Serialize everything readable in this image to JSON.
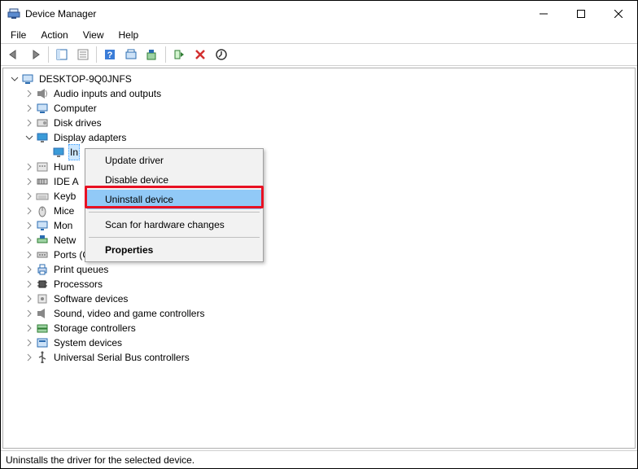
{
  "window": {
    "title": "Device Manager"
  },
  "menu": {
    "file": "File",
    "action": "Action",
    "view": "View",
    "help": "Help"
  },
  "tree": {
    "root": "DESKTOP-9Q0JNFS",
    "items": [
      {
        "label": "Audio inputs and outputs",
        "icon": "audio"
      },
      {
        "label": "Computer",
        "icon": "computer"
      },
      {
        "label": "Disk drives",
        "icon": "disk"
      },
      {
        "label": "Display adapters",
        "icon": "display",
        "expanded": true
      },
      {
        "label": "Human Interface Devices",
        "icon": "hid",
        "truncated": "Hum"
      },
      {
        "label": "IDE ATA/ATAPI controllers",
        "icon": "ide",
        "truncated": "IDE A"
      },
      {
        "label": "Keyboards",
        "icon": "keyboard",
        "truncated": "Keyb"
      },
      {
        "label": "Mice and other pointing devices",
        "icon": "mouse",
        "truncated": "Mice"
      },
      {
        "label": "Monitors",
        "icon": "monitor",
        "truncated": "Mon"
      },
      {
        "label": "Network adapters",
        "icon": "network",
        "truncated": "Netw"
      },
      {
        "label": "Ports (COM & LPT)",
        "icon": "ports"
      },
      {
        "label": "Print queues",
        "icon": "printer"
      },
      {
        "label": "Processors",
        "icon": "processor"
      },
      {
        "label": "Software devices",
        "icon": "software"
      },
      {
        "label": "Sound, video and game controllers",
        "icon": "sound"
      },
      {
        "label": "Storage controllers",
        "icon": "storage"
      },
      {
        "label": "System devices",
        "icon": "system"
      },
      {
        "label": "Universal Serial Bus controllers",
        "icon": "usb"
      }
    ],
    "display_child": "In"
  },
  "context_menu": {
    "items": [
      "Update driver",
      "Disable device",
      "Uninstall device",
      "Scan for hardware changes",
      "Properties"
    ],
    "highlighted_index": 2,
    "bold_index": 4
  },
  "statusbar": "Uninstalls the driver for the selected device."
}
